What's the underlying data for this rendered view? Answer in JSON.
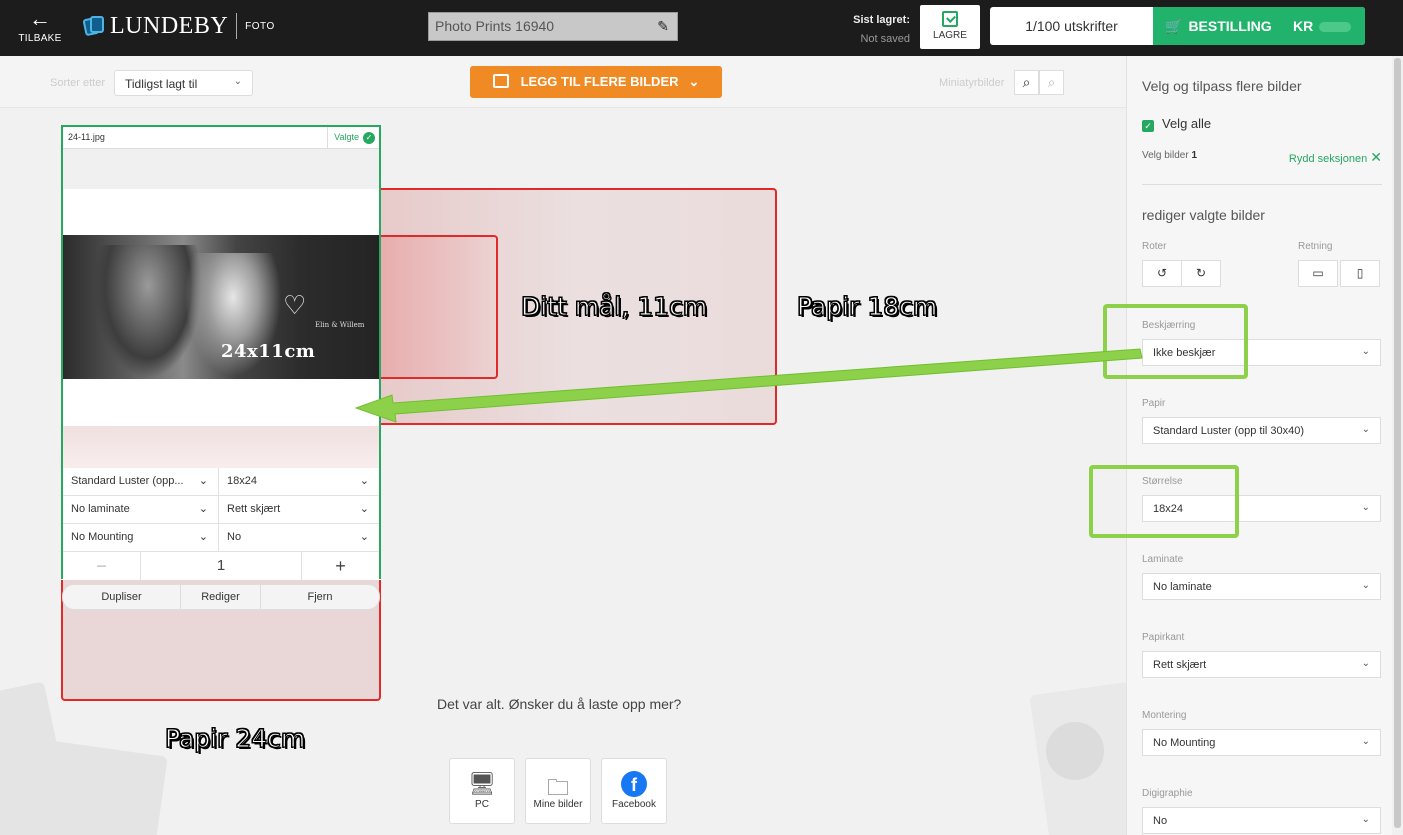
{
  "header": {
    "back_label": "TILBAKE",
    "brand": "LUNDEBY",
    "brand_sub": "FOTO",
    "project_name": "Photo Prints 16940",
    "saved_label": "Sist lagret:",
    "saved_value": "Not saved",
    "save_label": "LAGRE",
    "prints_count": "1/100 utskrifter",
    "order_label": "BESTILLING",
    "price_prefix": "KR"
  },
  "toolbar": {
    "sort_label": "Sorter etter",
    "sort_value": "Tidligst lagt til",
    "add_label": "LEGG TIL FLERE BILDER",
    "thumb_label": "Miniatyrbilder"
  },
  "card": {
    "filename": "24-11.jpg",
    "selected_label": "Valgte",
    "photo_caption": "24x11cm",
    "photo_names": "Elin & Willem",
    "options": [
      {
        "left": "Standard Luster (opp...",
        "right": "18x24"
      },
      {
        "left": "No laminate",
        "right": "Rett skjært"
      },
      {
        "left": "No Mounting",
        "right": "No"
      }
    ],
    "quantity": "1",
    "qty_minus": "−",
    "qty_plus": "+",
    "actions": [
      "Dupliser",
      "Rediger",
      "Fjern"
    ]
  },
  "annotations": {
    "target": "Ditt mål, 11cm",
    "paper18": "Papir 18cm",
    "paper24": "Papir 24cm"
  },
  "upload": {
    "question": "Det var alt. Ønsker du å laste opp mer?",
    "tiles": [
      {
        "label": "PC",
        "icon": "monitor-icon"
      },
      {
        "label": "Mine bilder",
        "icon": "folder-icon"
      },
      {
        "label": "Facebook",
        "icon": "facebook-icon"
      }
    ]
  },
  "sidebar": {
    "title": "Velg og tilpass flere bilder",
    "select_all": "Velg alle",
    "count_label": "Velg bilder",
    "count_value": "1",
    "clear_label": "Rydd seksjonen",
    "edit_title": "rediger valgte bilder",
    "rotate_label": "Roter",
    "orientation_label": "Retning",
    "fields": [
      {
        "label": "Beskjærring",
        "value": "Ikke beskjær"
      },
      {
        "label": "Papir",
        "value": "Standard Luster (opp til 30x40)"
      },
      {
        "label": "Størrelse",
        "value": "18x24"
      },
      {
        "label": "Laminate",
        "value": "No laminate"
      },
      {
        "label": "Papirkant",
        "value": "Rett skjært"
      },
      {
        "label": "Montering",
        "value": "No Mounting"
      },
      {
        "label": "Digigraphie",
        "value": "No"
      }
    ]
  },
  "colors": {
    "accent_green": "#27a861",
    "order_green": "#21b36b",
    "add_orange": "#f08a24",
    "annotation_red": "#e02a2a",
    "highlight_green": "#8dd14a"
  }
}
